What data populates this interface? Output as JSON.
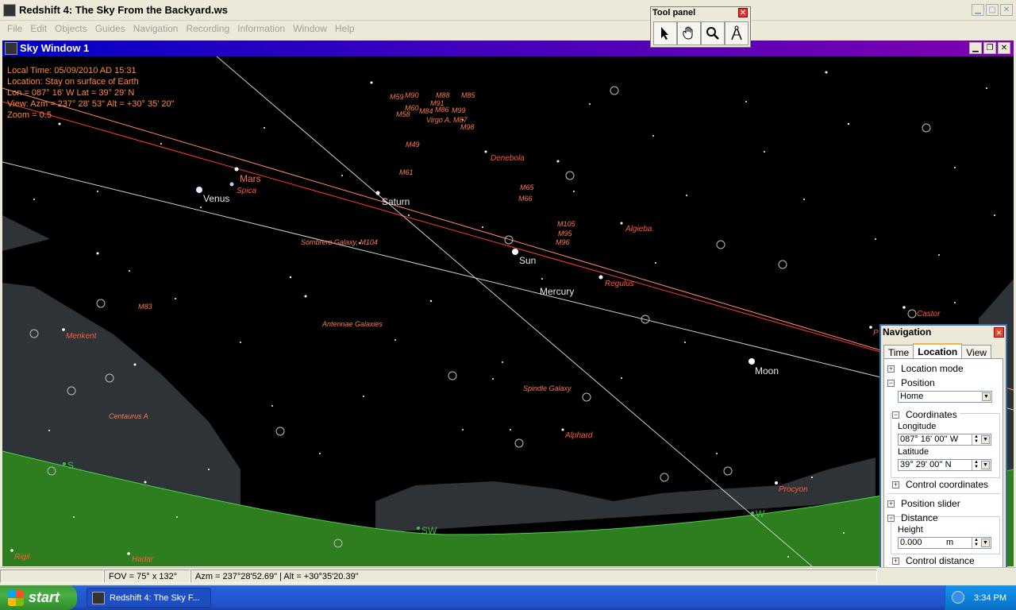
{
  "app": {
    "title": "Redshift 4: The Sky From the Backyard.ws",
    "menu": [
      "File",
      "Edit",
      "Objects",
      "Guides",
      "Navigation",
      "Recording",
      "Information",
      "Window",
      "Help"
    ]
  },
  "tool_panel": {
    "title": "Tool panel",
    "close": "✕",
    "tools": [
      "pointer-icon",
      "hand-icon",
      "magnifier-icon",
      "compass-icon"
    ]
  },
  "sky_window": {
    "title": "Sky Window 1",
    "info": {
      "local_time": "Local Time: 05/09/2010 AD 15:31",
      "location": "Location: Stay on surface of Earth",
      "lonlat": "Lon = 087° 16' W   Lat = 39° 29' N",
      "view": "View:  Azm = 237° 28' 53\"   Alt = +30° 35' 20\"",
      "zoom": "Zoom = 0.5"
    },
    "planets": {
      "venus": "Venus",
      "mars": "Mars",
      "saturn": "Saturn",
      "sun": "Sun",
      "mercury": "Mercury",
      "moon": "Moon"
    },
    "stars": {
      "spica": "Spica",
      "denebola": "Denebola",
      "algieba": "Algieba",
      "regulus": "Regulus",
      "menkent": "Menkent",
      "alphard": "Alphard",
      "procyon": "Procyon",
      "castor": "Castor",
      "pollux": "P",
      "hadar": "Hadar",
      "rigil": "Rigil"
    },
    "deep_sky": {
      "m59": "M59",
      "m90": "M90",
      "m88": "M88",
      "m85": "M85",
      "m91": "M91",
      "m60": "M60",
      "m84": "M84",
      "m86": "M86",
      "m99": "M99",
      "m58": "M58",
      "virgo": "Virgo A, M87",
      "m98": "M98",
      "m49": "M49",
      "m61": "M61",
      "m65": "M65",
      "m66": "M66",
      "m105": "M105",
      "m95": "M95",
      "m96": "M96",
      "sombrero": "Sombrero Galaxy, M104",
      "m83": "M83",
      "antennae": "Antennae Galaxies",
      "spindle": "Spindle Galaxy",
      "centaurus": "Centaurus A"
    },
    "compass": {
      "s": "S",
      "sw": "SW",
      "w": "W"
    }
  },
  "statusbar": {
    "fov": "FOV = 75° x 132°",
    "coords": "Azm = 237°28'52.69\" | Alt = +30°35'20.39\""
  },
  "taskbar": {
    "start": "start",
    "task": "Redshift 4: The Sky F...",
    "clock": "3:34 PM"
  },
  "navigation": {
    "title": "Navigation",
    "tabs": [
      "Time",
      "Location",
      "View"
    ],
    "location_mode": "Location mode",
    "position": "Position",
    "position_value": "Home",
    "coordinates": "Coordinates",
    "longitude": "Longitude",
    "longitude_value": "087° 16' 00'' W",
    "latitude": "Latitude",
    "latitude_value": " 39° 29' 00'' N",
    "control_coordinates": "Control coordinates",
    "position_slider": "Position slider",
    "distance": "Distance",
    "height": "Height",
    "height_value": "0.000",
    "height_unit": "m",
    "control_distance": "Control distance"
  },
  "colors": {
    "ecliptic": "#ff3a2a",
    "horizon": "#2e7d1e",
    "ground_fog": "#2e3338",
    "title_gradient_start": "#0000c8",
    "title_gradient_end": "#8000b0"
  }
}
